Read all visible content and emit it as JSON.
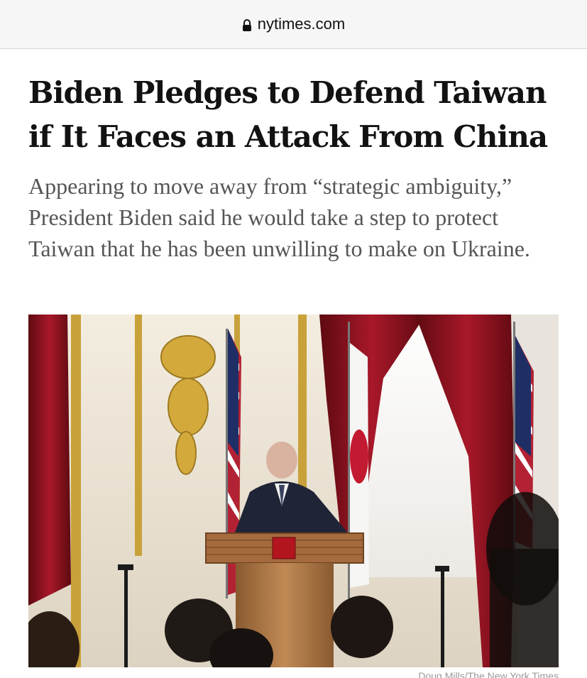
{
  "browser": {
    "url": "nytimes.com",
    "lock_icon": "lock-icon"
  },
  "article": {
    "headline": "Biden Pledges to Defend Taiwan if It Faces an Attack From China",
    "summary": "Appearing to move away from “strategic ambiguity,” President Biden said he would take a step to protect Taiwan that he has been unwilling to make on Ukraine.",
    "photo_credit": "Doug Mills/The New York Times"
  },
  "colors": {
    "headline": "#121212",
    "summary": "#555555",
    "curtain_red": "#9c1620",
    "gold": "#c9a13b"
  }
}
